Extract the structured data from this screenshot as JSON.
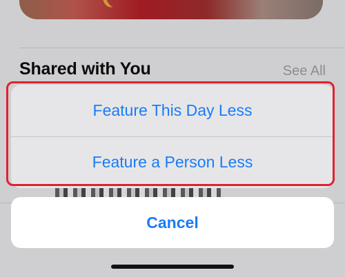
{
  "background": {
    "section_title": "Shared with You",
    "see_all_label": "See All"
  },
  "action_sheet": {
    "items": [
      {
        "label": "Feature This Day Less"
      },
      {
        "label": "Feature a Person Less"
      }
    ],
    "cancel_label": "Cancel"
  },
  "colors": {
    "accent": "#1a7cf5",
    "highlight_outline": "#e2202d",
    "sheet_background": "#e6e6e8",
    "cancel_background": "#ffffff"
  }
}
